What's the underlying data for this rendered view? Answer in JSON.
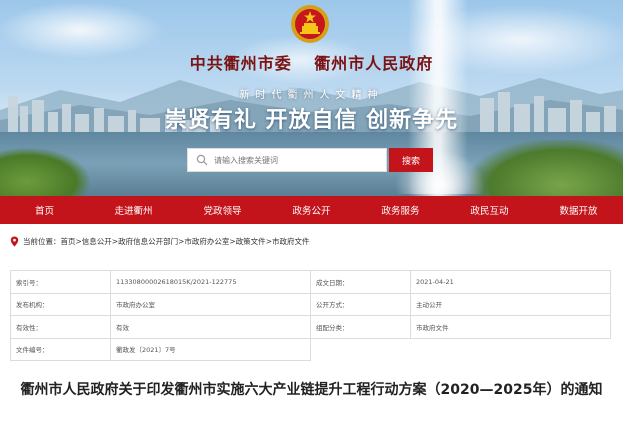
{
  "header": {
    "org_left": "中共衢州市委",
    "org_right": "衢州市人民政府",
    "slogan_small": "新时代衢州人文精神",
    "slogan_big": "崇贤有礼 开放自信 创新争先",
    "emblem_icon": "national-emblem-icon"
  },
  "search": {
    "placeholder": "请输入搜索关键词",
    "button_label": "搜索"
  },
  "nav": {
    "items": [
      "首页",
      "走进衢州",
      "党政领导",
      "政务公开",
      "政务服务",
      "政民互动",
      "数据开放"
    ]
  },
  "breadcrumb": {
    "prefix": "当前位置：",
    "items": [
      "首页",
      "信息公开",
      "政府信息公开部门",
      "市政府办公室",
      "政策文件",
      "市政府文件"
    ],
    "separator": ">"
  },
  "info": {
    "index_label": "索引号：",
    "index_value": "113308000026180​15K/2021-122775",
    "date_label": "成文日期：",
    "date_value": "2021-04-21",
    "publisher_label": "发布机构：",
    "publisher_value": "市政府办公室",
    "method_label": "公开方式：",
    "method_value": "主动公开",
    "validity_label": "有效性：",
    "validity_value": "有效",
    "category_label": "组配分类：",
    "category_value": "市政府文件",
    "docno_label": "文件编号：",
    "docno_value": "衢政发〔2021〕7号"
  },
  "document": {
    "title": "衢州市人民政府关于印发衢州市实施六大产业链提升工程行动方案（2020—2025年）的通知"
  },
  "colors": {
    "brand_red": "#c4141b",
    "title_red": "#7a1414"
  }
}
